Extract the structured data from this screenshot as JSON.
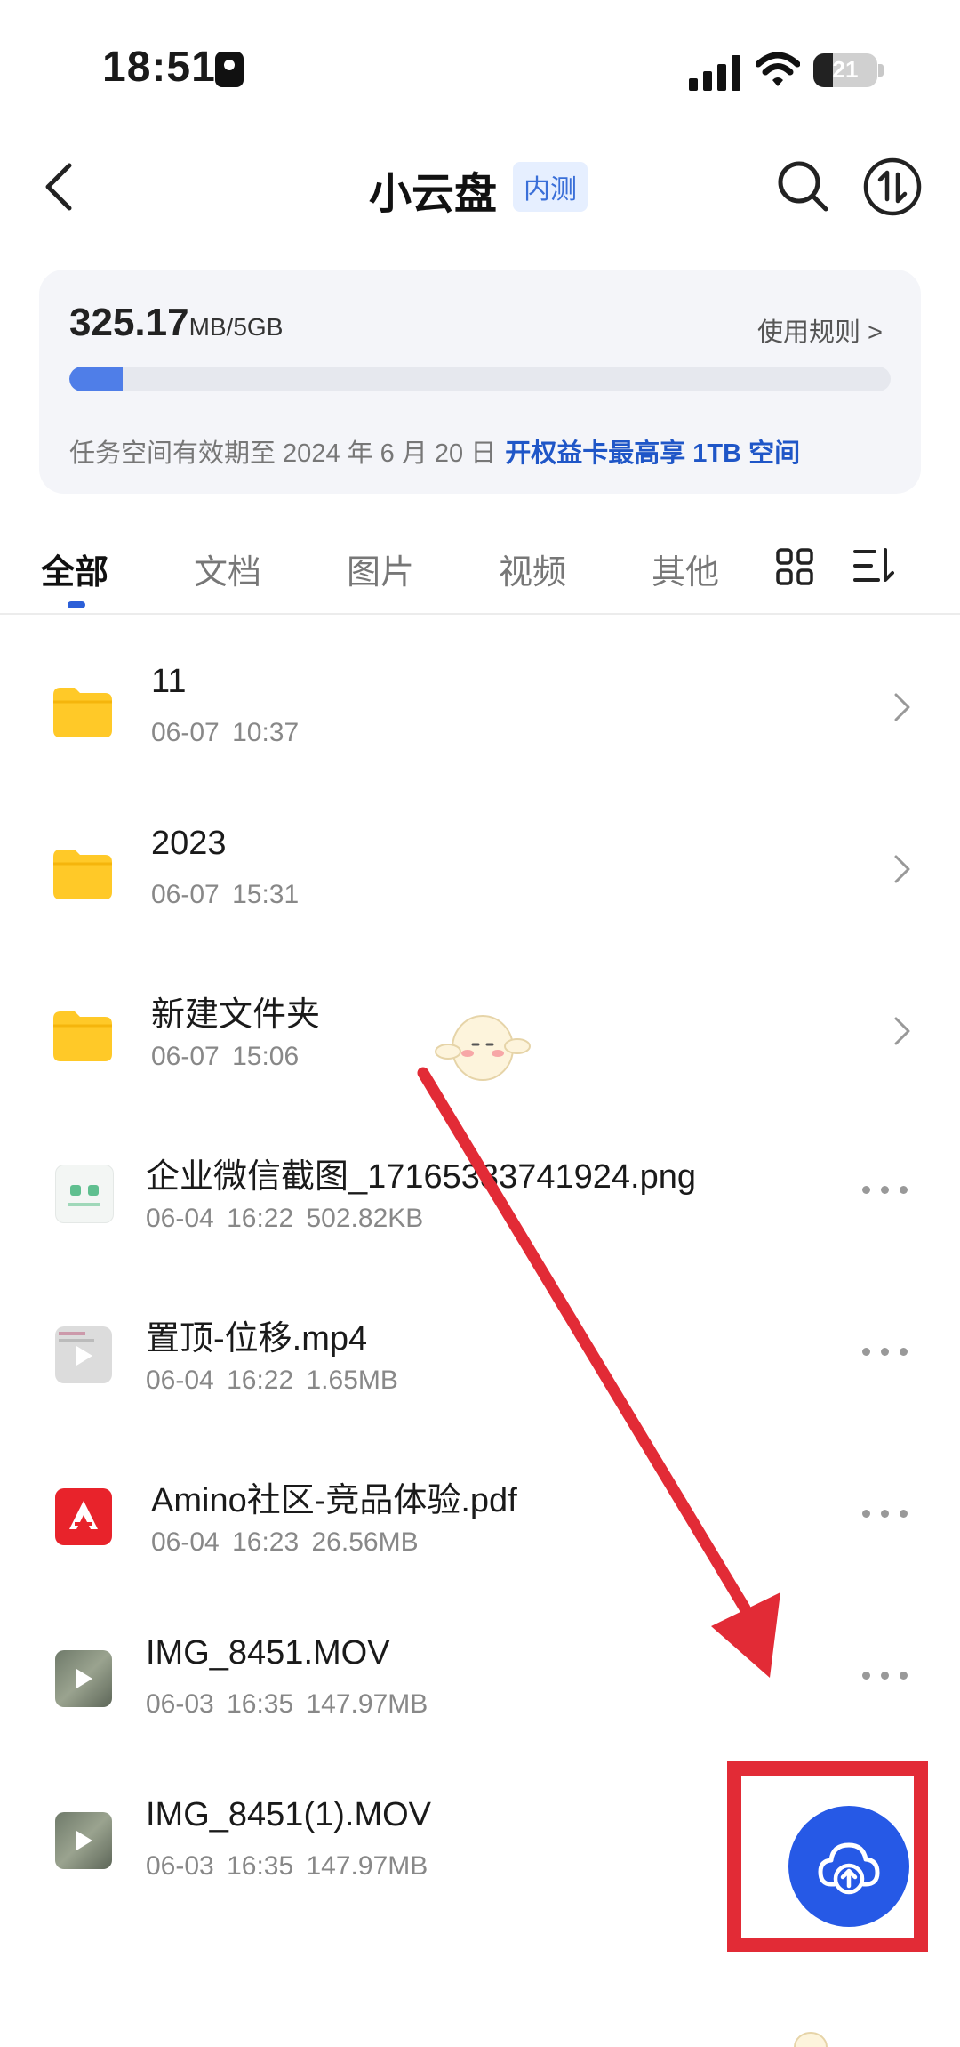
{
  "status_bar": {
    "time": "18:51",
    "battery": "21"
  },
  "header": {
    "title": "小云盘",
    "badge": "内测"
  },
  "storage": {
    "used_value": "325.17",
    "used_unit": "MB/5GB",
    "rules_label": "使用规则 >",
    "usage_fraction": 0.065,
    "expiry_text": "任务空间有效期至 2024 年 6 月 20 日",
    "expiry_link": "开权益卡最高享 1TB 空间"
  },
  "tabs": [
    {
      "label": "全部",
      "active": true
    },
    {
      "label": "文档"
    },
    {
      "label": "图片"
    },
    {
      "label": "视频"
    },
    {
      "label": "其他"
    }
  ],
  "files": [
    {
      "name": "11",
      "date": "06-07",
      "time": "10:37",
      "size": "",
      "type": "folder"
    },
    {
      "name": "2023",
      "date": "06-07",
      "time": "15:31",
      "size": "",
      "type": "folder"
    },
    {
      "name": "新建文件夹",
      "date": "06-07",
      "time": "15:06",
      "size": "",
      "type": "folder"
    },
    {
      "name": "企业微信截图_17165333741924.png",
      "date": "06-04",
      "time": "16:22",
      "size": "502.82KB",
      "type": "image"
    },
    {
      "name": "置顶-位移.mp4",
      "date": "06-04",
      "time": "16:22",
      "size": "1.65MB",
      "type": "video"
    },
    {
      "name": "Amino社区-竞品体验.pdf",
      "date": "06-04",
      "time": "16:23",
      "size": "26.56MB",
      "type": "pdf"
    },
    {
      "name": "IMG_8451.MOV",
      "date": "06-03",
      "time": "16:35",
      "size": "147.97MB",
      "type": "video"
    },
    {
      "name": "IMG_8451(1).MOV",
      "date": "06-03",
      "time": "16:35",
      "size": "147.97MB",
      "type": "video"
    }
  ],
  "colors": {
    "accent": "#2659e6",
    "folder": "#ffc928",
    "annotation": "#e22b36"
  },
  "icons": {
    "back": "chevron-left-icon",
    "search": "search-icon",
    "sort": "sort-updown-icon",
    "grid": "grid-view-icon",
    "list": "list-sort-icon",
    "upload": "cloud-upload-icon"
  }
}
